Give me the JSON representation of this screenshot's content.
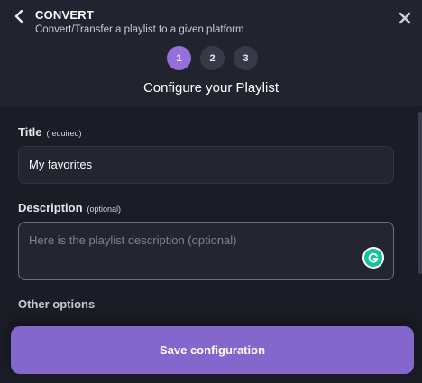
{
  "header": {
    "title": "CONVERT",
    "subtitle": "Convert/Transfer a playlist to a given platform",
    "back_icon": "chevron-left-icon",
    "close_icon": "close-icon"
  },
  "steps": {
    "items": [
      "1",
      "2",
      "3"
    ],
    "active": "1",
    "active_color": "#9470dc",
    "heading": "Configure your Playlist"
  },
  "form": {
    "title_label": "Title",
    "title_hint": "(required)",
    "title_value": "My favorites",
    "description_label": "Description",
    "description_hint": "(optional)",
    "description_placeholder": "Here is the playlist description (optional)",
    "other_options_label": "Other options"
  },
  "actions": {
    "save_label": "Save configuration",
    "save_color": "#8467cc"
  }
}
